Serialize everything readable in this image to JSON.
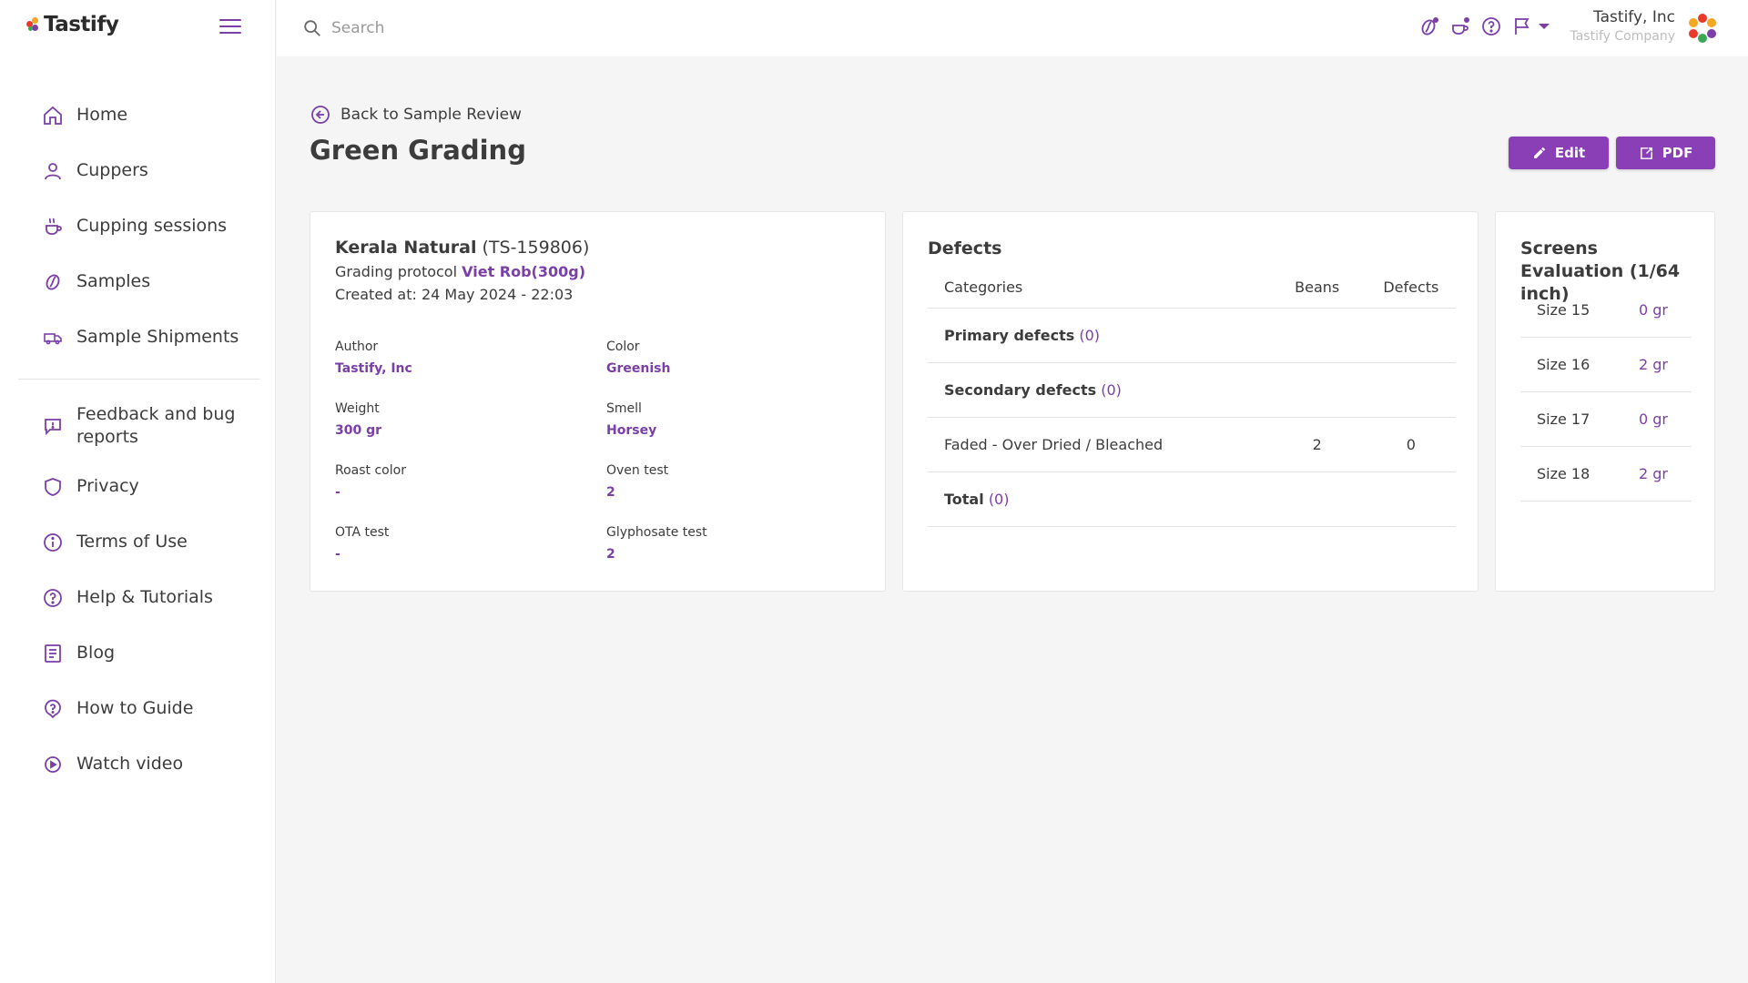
{
  "app": {
    "logo_text": "Tastify",
    "brand_color": "#8a3fb7"
  },
  "sidebar": {
    "items": [
      {
        "label": "Home",
        "icon": "home-icon"
      },
      {
        "label": "Cuppers",
        "icon": "person-icon"
      },
      {
        "label": "Cupping sessions",
        "icon": "cup-icon"
      },
      {
        "label": "Samples",
        "icon": "bean-icon"
      },
      {
        "label": "Sample Shipments",
        "icon": "truck-icon"
      }
    ],
    "secondary": [
      {
        "label": "Feedback and bug reports",
        "icon": "feedback-icon"
      },
      {
        "label": "Privacy",
        "icon": "shield-icon"
      },
      {
        "label": "Terms of Use",
        "icon": "info-icon"
      },
      {
        "label": "Help & Tutorials",
        "icon": "help-icon"
      },
      {
        "label": "Blog",
        "icon": "blog-icon"
      },
      {
        "label": "How to Guide",
        "icon": "guide-icon"
      },
      {
        "label": "Watch video",
        "icon": "play-icon"
      }
    ]
  },
  "header": {
    "search_placeholder": "Search",
    "user_name": "Tastify, Inc",
    "company": "Tastify Company"
  },
  "page": {
    "back_label": "Back to Sample Review",
    "title": "Green Grading",
    "edit_label": "Edit",
    "pdf_label": "PDF"
  },
  "sample": {
    "name": "Kerala Natural",
    "code": "(TS-159806)",
    "protocol_label": "Grading protocol",
    "protocol_value": "Viet Rob(300g)",
    "created": "Created at: 24 May 2024 - 22:03",
    "fields": [
      {
        "label": "Author",
        "value": "Tastify, Inc"
      },
      {
        "label": "Color",
        "value": "Greenish"
      },
      {
        "label": "Weight",
        "value": "300 gr"
      },
      {
        "label": "Smell",
        "value": "Horsey"
      },
      {
        "label": "Roast color",
        "value": "-"
      },
      {
        "label": "Oven test",
        "value": "2"
      },
      {
        "label": "OTA test",
        "value": "-"
      },
      {
        "label": "Glyphosate test",
        "value": "2"
      }
    ]
  },
  "defects": {
    "title": "Defects",
    "headers": {
      "categories": "Categories",
      "beans": "Beans",
      "defects": "Defects"
    },
    "primary_label": "Primary defects",
    "primary_count": "(0)",
    "secondary_label": "Secondary defects",
    "secondary_count": "(0)",
    "rows": [
      {
        "name": "Faded - Over Dried / Bleached",
        "beans": "2",
        "defects": "0"
      }
    ],
    "total_label": "Total",
    "total_count": "(0)"
  },
  "screens": {
    "title": "Screens Evaluation (1/64 inch)",
    "rows": [
      {
        "size": "Size 15",
        "value": "0 gr"
      },
      {
        "size": "Size 16",
        "value": "2 gr"
      },
      {
        "size": "Size 17",
        "value": "0 gr"
      },
      {
        "size": "Size 18",
        "value": "2 gr"
      }
    ]
  }
}
